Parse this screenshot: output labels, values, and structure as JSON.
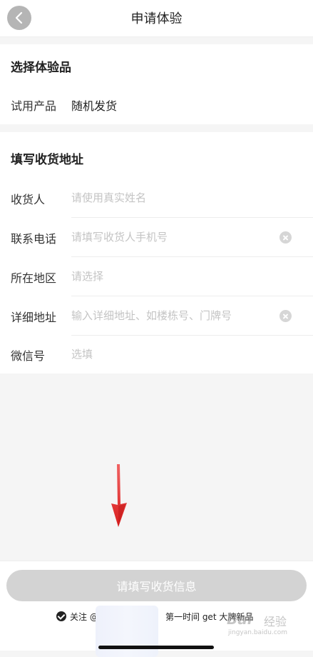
{
  "header": {
    "title": "申请体验",
    "back_icon": "chevron-left-icon"
  },
  "product_section": {
    "title": "选择体验品",
    "trial_label": "试用产品",
    "trial_value": "随机发货"
  },
  "address_section": {
    "title": "填写收货地址",
    "fields": [
      {
        "label": "收货人",
        "placeholder": "请使用真实姓名"
      },
      {
        "label": "联系电话",
        "placeholder": "请填写收货人手机号"
      },
      {
        "label": "所在地区",
        "placeholder": "请选择"
      },
      {
        "label": "详细地址",
        "placeholder": "输入详细地址、如楼栋号、门牌号"
      },
      {
        "label": "微信号",
        "placeholder": "选填"
      }
    ]
  },
  "footer": {
    "submit_label": "请填写收货信息",
    "follow_prefix": "关注 @",
    "follow_suffix": "第一时间 get 大牌新品"
  },
  "watermark": {
    "logo": "Bai",
    "text": "经验",
    "url": "jingyan.baidu.com"
  },
  "colors": {
    "accent_arrow": "#e02020",
    "submit_disabled": "#d3d3d3",
    "placeholder": "#c4c4c4",
    "background": "#f5f5f5"
  }
}
